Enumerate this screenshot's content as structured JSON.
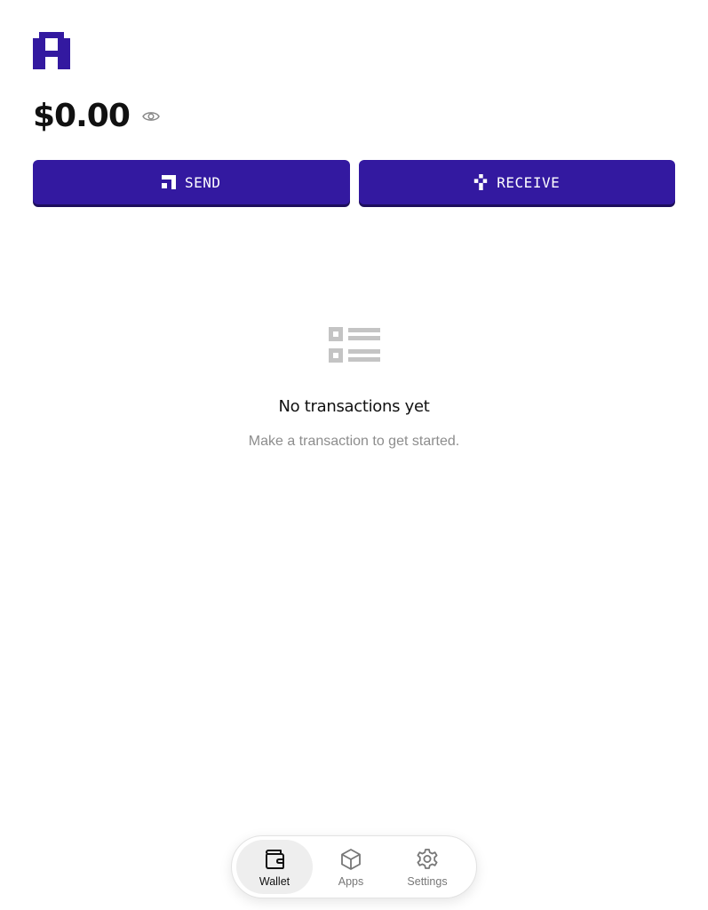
{
  "brand": {
    "logo_icon": "pixel-a-logo-icon",
    "accent": "#3319a0",
    "accent_shadow": "#1d0e5c"
  },
  "wallet": {
    "balance": "$0.00",
    "visibility_icon": "eye-icon"
  },
  "actions": {
    "send_label": "SEND",
    "send_icon": "send-pixel-icon",
    "receive_label": "RECEIVE",
    "receive_icon": "receive-pixel-icon"
  },
  "empty_state": {
    "icon": "list-icon",
    "title": "No transactions yet",
    "subtitle": "Make a transaction to get started."
  },
  "navbar": {
    "items": [
      {
        "label": "Wallet",
        "icon": "wallet-icon",
        "active": true
      },
      {
        "label": "Apps",
        "icon": "box-icon",
        "active": false
      },
      {
        "label": "Settings",
        "icon": "gear-icon",
        "active": false
      }
    ]
  }
}
